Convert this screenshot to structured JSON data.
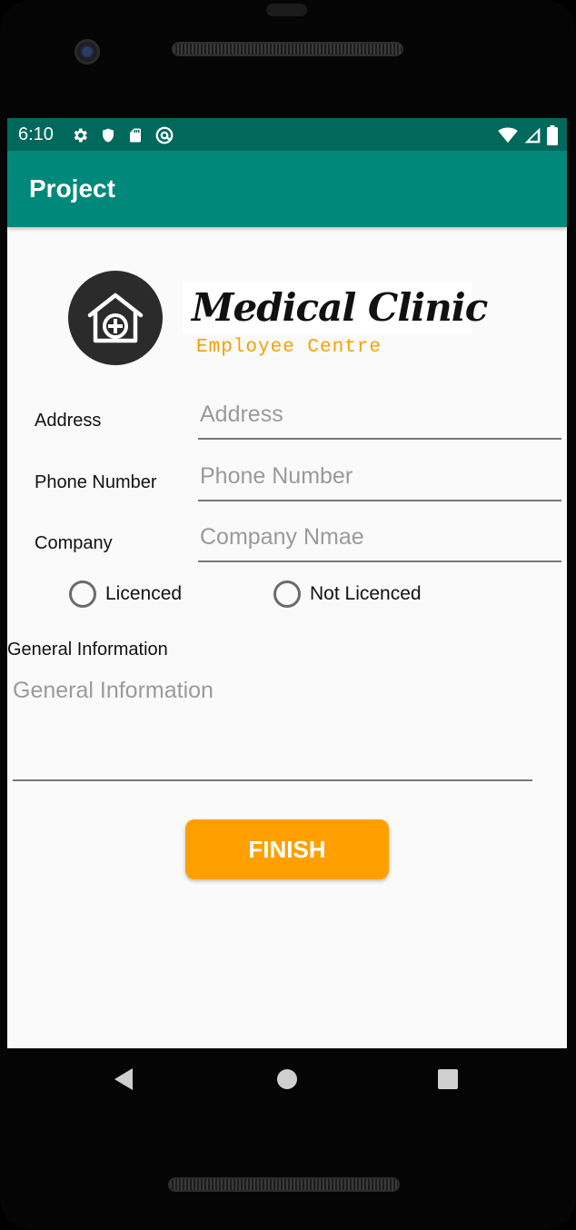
{
  "status_bar": {
    "time": "6:10",
    "icons_left": [
      "gear-icon",
      "shield-icon",
      "sd-card-icon",
      "at-sign-icon"
    ],
    "icons_right": [
      "wifi-icon",
      "signal-icon",
      "battery-icon"
    ]
  },
  "app_bar": {
    "title": "Project"
  },
  "brand": {
    "name": "Medical Clinic",
    "subtitle": "Employee Centre",
    "logo_icon": "home-plus-icon"
  },
  "form": {
    "address": {
      "label": "Address",
      "placeholder": "Address",
      "value": ""
    },
    "phone": {
      "label": "Phone Number",
      "placeholder": "Phone Number",
      "value": ""
    },
    "company": {
      "label": "Company",
      "placeholder": "Company Nmae",
      "value": ""
    },
    "licence_options": [
      {
        "label": "Licenced",
        "selected": false
      },
      {
        "label": "Not Licenced",
        "selected": false
      }
    ],
    "general_info": {
      "label": "General Information",
      "placeholder": "General Information",
      "value": ""
    },
    "finish_label": "FINISH"
  },
  "nav_bar": {
    "icons": [
      "back-icon",
      "home-icon",
      "recents-icon"
    ]
  },
  "colors": {
    "status_bar": "#00695c",
    "app_bar": "#00897b",
    "accent": "#ffa000",
    "subtitle": "#f5a000"
  }
}
